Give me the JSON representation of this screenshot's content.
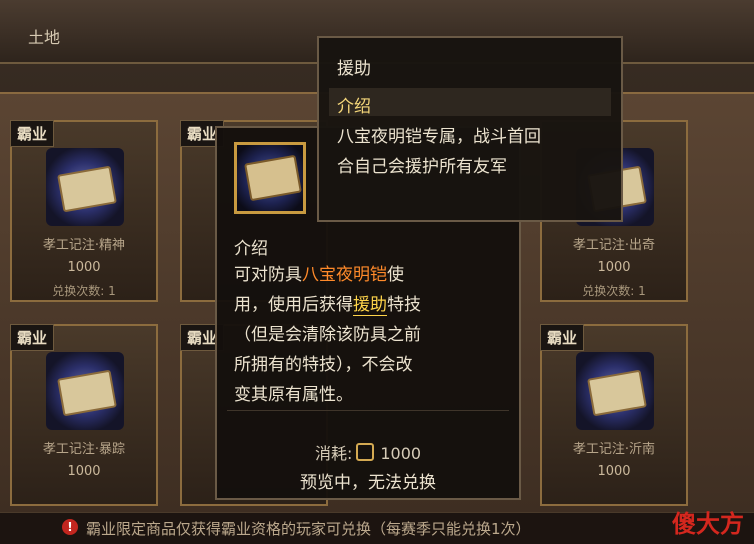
{
  "header": {
    "title": "土地"
  },
  "cards": [
    {
      "tag": "霸业",
      "name": "孝工记注·精神",
      "cost": "1000",
      "limit": "兑换次数: 1"
    },
    {
      "tag": "霸业",
      "name": "",
      "cost": "",
      "limit": ""
    },
    {
      "tag": "",
      "name": "孝工记注·出奇",
      "cost": "1000",
      "limit": "兑换次数: 1"
    },
    {
      "tag": "霸业",
      "name": "孝工记注·暴踪",
      "cost": "1000",
      "limit": ""
    },
    {
      "tag": "霸业",
      "name": "",
      "cost": "",
      "limit": ""
    },
    {
      "tag": "霸业",
      "name": "孝工记注·沂南",
      "cost": "1000",
      "limit": ""
    }
  ],
  "item_tooltip": {
    "section": "介绍",
    "line1_prefix": "可对防具",
    "line1_highlight": "八宝夜明铠",
    "line1_suffix": "使",
    "line2_prefix": "用，使用后获得",
    "line2_highlight": "援助",
    "line2_suffix": "特技",
    "line3": "（但是会清除该防具之前",
    "line4": "所拥有的特技），不会改",
    "line5": "变其原有属性。",
    "cost_label": "消耗:",
    "cost_value": "1000",
    "preview": "预览中，无法兑换"
  },
  "skill_tooltip": {
    "title": "援助",
    "header": "介绍",
    "desc_line1": "八宝夜明铠专属，战斗首回",
    "desc_line2": "合自己会援护所有友军"
  },
  "footer": {
    "text": "霸业限定商品仅获得霸业资格的玩家可兑换（每赛季只能兑换1次）"
  },
  "watermark": "傻大方"
}
